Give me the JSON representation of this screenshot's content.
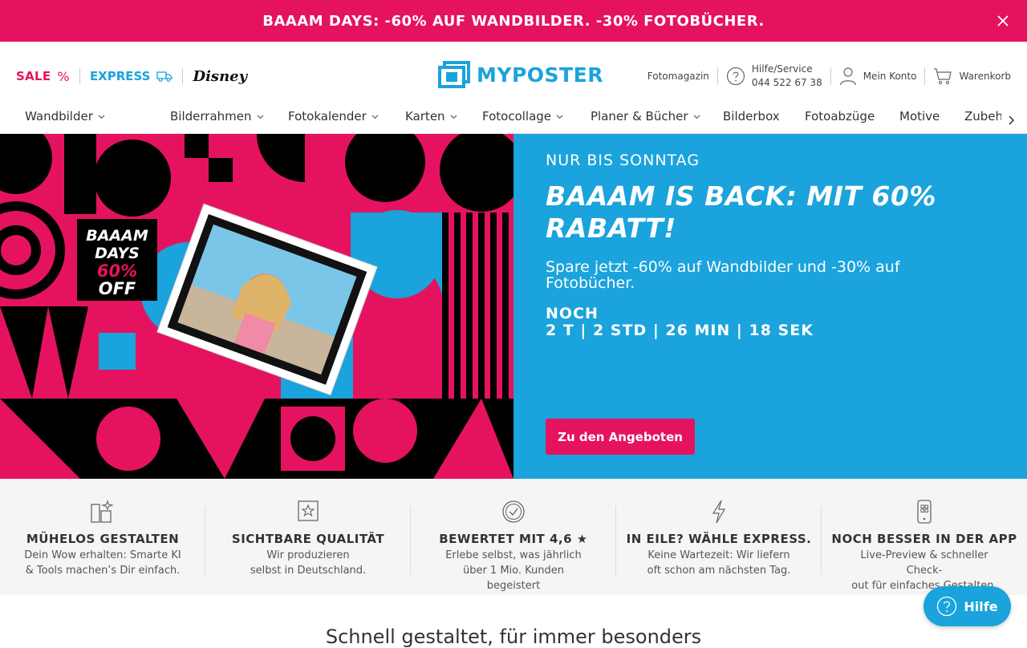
{
  "promo_bar": {
    "text": "BAAAM DAYS: -60% AUF WANDBILDER. -30% FOTOBÜCHER."
  },
  "header": {
    "sale_label": "SALE",
    "sale_icon": "%",
    "express_label": "EXPRESS",
    "disney_label": "Disney",
    "logo_text": "MYPOSTER",
    "magazin_label": "Fotomagazin",
    "help_label": "Hilfe/Service",
    "help_phone": "044 522 67 38",
    "account_label": "Mein Konto",
    "cart_label": "Warenkorb"
  },
  "nav": {
    "items": [
      {
        "label": "Wandbilder"
      },
      {
        "label": "Bilderrahmen"
      },
      {
        "label": "Fotokalender"
      },
      {
        "label": "Karten"
      },
      {
        "label": "Fotocollage"
      },
      {
        "label": "Planer & Bücher"
      },
      {
        "label": "Bilderbox"
      },
      {
        "label": "Fotoabzüge"
      },
      {
        "label": "Motive"
      },
      {
        "label": "Zubeh"
      }
    ]
  },
  "hero": {
    "badge_lines": [
      "BAAAM",
      "DAYS",
      "60%",
      "OFF"
    ],
    "eyebrow": "NUR BIS SONNTAG",
    "headline": "BAAAM IS BACK: MIT 60% RABATT!",
    "sub": "Spare jetzt -60% auf Wandbilder und -30% auf Fotobücher.",
    "countdown_label": "NOCH",
    "countdown": "2 T | 2 STD | 26 MIN | 18 SEK",
    "cta": "Zu den Angeboten"
  },
  "features": [
    {
      "icon": "design-tools-icon",
      "title": "MÜHELOS GESTALTEN",
      "line1": "Dein Wow erhalten: Smarte KI",
      "line2": "& Tools machen’s Dir einfach."
    },
    {
      "icon": "quality-star-icon",
      "title": "SICHTBARE QUALITÄT",
      "line1": "Wir produzieren",
      "line2": "selbst in Deutschland."
    },
    {
      "icon": "checkmark-circle-icon",
      "title": "BEWERTET MIT 4,6 ★",
      "line1": "Erlebe selbst, was jährlich",
      "line2": "über 1 Mio. Kunden begeistert"
    },
    {
      "icon": "lightning-icon",
      "title": "IN EILE? WÄHLE EXPRESS.",
      "line1": "Keine Wartezeit: Wir liefern",
      "line2": "oft schon am nächsten Tag."
    },
    {
      "icon": "app-phone-icon",
      "title": "NOCH BESSER IN DER APP",
      "line1": "Live-Preview & schneller Check-",
      "line2": "out für einfaches Gestalten."
    }
  ],
  "section_title": "Schnell gestaltet, für immer besonders",
  "help_button": {
    "label": "Hilfe"
  },
  "colors": {
    "brand_pink": "#e5135f",
    "brand_blue": "#1aa3dc"
  }
}
